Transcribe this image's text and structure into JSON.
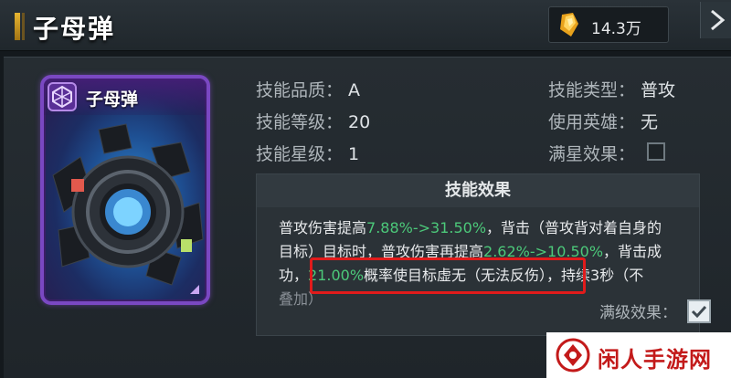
{
  "header": {
    "title": "子母弹",
    "currency_value": "14.3万"
  },
  "card": {
    "name": "子母弹"
  },
  "attributes": {
    "quality_label": "技能品质：",
    "quality_value": "A",
    "level_label": "技能等级：",
    "level_value": "20",
    "star_label": "技能星级：",
    "star_value": "1",
    "type_label": "技能类型：",
    "type_value": "普攻",
    "hero_label": "使用英雄：",
    "hero_value": "无",
    "fullstar_label": "满星效果："
  },
  "effect": {
    "title": "技能效果",
    "line1_a": "普攻伤害提高",
    "line1_hl": "7.88%->31.50%",
    "line1_b": "，背击（普攻背对着自身的",
    "line2_a": "目标）目标时，普攻伤害再提高",
    "line2_hl": "2.62%->10.50%",
    "line2_b": "，背击成",
    "line3_a": "功，",
    "line3_hl": "21.00%",
    "line3_b": "概率使目标虚无（无法反伤），持续3秒（不",
    "line4": "叠加）"
  },
  "max_level": {
    "label": "满级效果："
  },
  "watermark": {
    "text": "闲人手游网"
  },
  "colors": {
    "highlight": "#4cc97a",
    "frame": "#e11b1b",
    "card_border": "#7a48c2"
  }
}
